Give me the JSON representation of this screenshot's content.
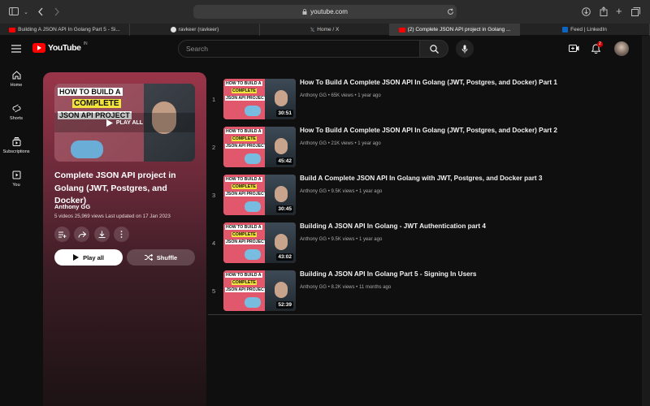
{
  "browser": {
    "url": "youtube.com",
    "tabs": [
      {
        "label": "Building A JSON API In Golang Part 5 - Si...",
        "favicon": "youtube-icon",
        "active": false
      },
      {
        "label": "ravkeer (ravkeer)",
        "favicon": "github-icon",
        "active": false
      },
      {
        "label": "Home / X",
        "favicon": "x-icon",
        "active": false
      },
      {
        "label": "(2) Complete JSON API project in Golang ...",
        "favicon": "youtube-icon",
        "active": true
      },
      {
        "label": "Feed | LinkedIn",
        "favicon": "linkedin-icon",
        "active": false
      }
    ]
  },
  "header": {
    "logo_text": "YouTube",
    "country": "IN",
    "search_placeholder": "Search",
    "notification_count": "2"
  },
  "sidebar": {
    "items": [
      {
        "label": "Home",
        "icon": "home-icon"
      },
      {
        "label": "Shorts",
        "icon": "shorts-icon"
      },
      {
        "label": "Subscriptions",
        "icon": "subscriptions-icon"
      },
      {
        "label": "You",
        "icon": "you-icon"
      }
    ]
  },
  "playlist": {
    "title": "Complete JSON API project in Golang (JWT, Postgres, and Docker)",
    "owner": "Anthony GG",
    "meta": "5 videos   25,969 views   Last updated on 17 Jan 2023",
    "play_all_overlay": "PLAY ALL",
    "thumb_line1": "HOW TO BUILD A",
    "thumb_line2": "COMPLETE",
    "thumb_line3": "JSON API PROJECT",
    "play_all_label": "Play all",
    "shuffle_label": "Shuffle"
  },
  "videos": [
    {
      "index": "1",
      "title": "How To Build A Complete JSON API In Golang (JWT, Postgres, and Docker) Part 1",
      "channel": "Anthony GG",
      "views": "65K views",
      "age": "1 year ago",
      "duration": "30:51"
    },
    {
      "index": "2",
      "title": "How To Build A Complete JSON API In Golang (JWT, Postgres, and Docker) Part 2",
      "channel": "Anthony GG",
      "views": "21K views",
      "age": "1 year ago",
      "duration": "45:42"
    },
    {
      "index": "3",
      "title": "Build A Complete JSON API In Golang with JWT, Postgres, and Docker part 3",
      "channel": "Anthony GG",
      "views": "9.5K views",
      "age": "1 year ago",
      "duration": "30:45"
    },
    {
      "index": "4",
      "title": "Building A JSON API In Golang - JWT Authentication part 4",
      "channel": "Anthony GG",
      "views": "9.5K views",
      "age": "1 year ago",
      "duration": "43:02"
    },
    {
      "index": "5",
      "title": "Building A JSON API In Golang Part 5 - Signing In Users",
      "channel": "Anthony GG",
      "views": "8.2K views",
      "age": "11 months ago",
      "duration": "52:39"
    }
  ],
  "thumb_text": {
    "line1": "HOW TO BUILD A",
    "line2": "COMPLETE",
    "line3": "JSON API PROJECT"
  },
  "colors": {
    "brand_red": "#ff0000",
    "panel_top": "#9a3549",
    "background": "#0f0f0f"
  }
}
